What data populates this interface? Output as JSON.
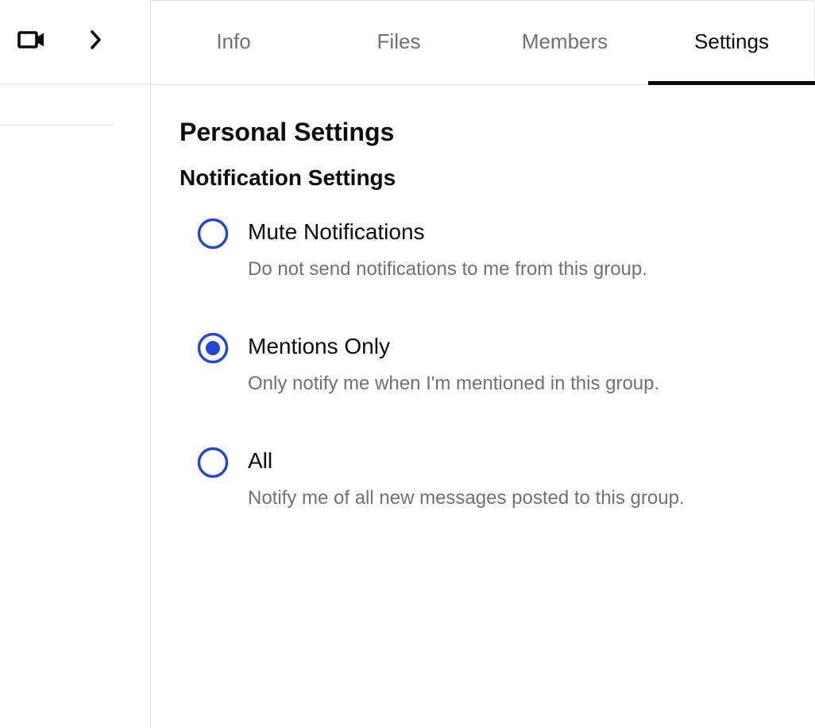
{
  "toolbar": {
    "video_icon": "video-camera-icon",
    "chevron_icon": "chevron-right-icon"
  },
  "tabs": [
    {
      "label": "Info",
      "active": false
    },
    {
      "label": "Files",
      "active": false
    },
    {
      "label": "Members",
      "active": false
    },
    {
      "label": "Settings",
      "active": true
    }
  ],
  "settings": {
    "title": "Personal Settings",
    "section": "Notification Settings",
    "options": [
      {
        "label": "Mute Notifications",
        "description": "Do not send notifications to me from this group.",
        "selected": false
      },
      {
        "label": "Mentions Only",
        "description": "Only notify me when I'm mentioned in this group.",
        "selected": true
      },
      {
        "label": "All",
        "description": "Notify me of all new messages posted to this group.",
        "selected": false
      }
    ]
  },
  "colors": {
    "accent": "#2346d9",
    "text_primary": "#0b0b0f",
    "text_muted": "#6f7079",
    "border": "#e2e3e7"
  }
}
